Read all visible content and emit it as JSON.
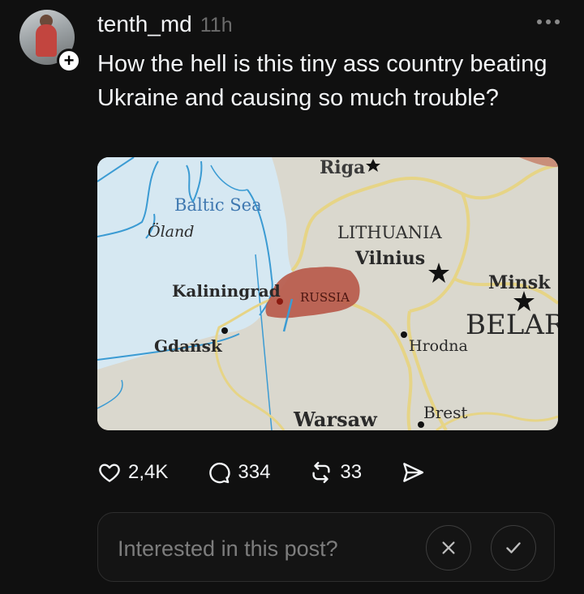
{
  "post": {
    "username": "tenth_md",
    "time": "11h",
    "text": "How the hell is this tiny ass country beating Ukraine and causing so much trouble?",
    "follow_glyph": "+"
  },
  "map": {
    "labels": {
      "riga": "Riga",
      "baltic_sea": "Baltic Sea",
      "oland": "Öland",
      "lithuania": "LITHUANIA",
      "vilnius": "Vilnius",
      "minsk": "Minsk",
      "kaliningrad": "Kaliningrad",
      "russia": "RUSSIA",
      "belarus": "BELAR",
      "gdansk": "Gdańsk",
      "hrodna": "Hrodna",
      "warsaw": "Warsaw",
      "brest": "Brest"
    },
    "colors": {
      "water": "#d6e8f2",
      "land": "#dbd9cf",
      "border": "#e6d486",
      "russia_fill": "#b85a4b",
      "river": "#3b9bd3"
    }
  },
  "actions": {
    "likes": "2,4K",
    "replies": "334",
    "reposts": "33"
  },
  "interest": {
    "question": "Interested in this post?"
  },
  "icons": [
    "heart-icon",
    "comment-icon",
    "repost-icon",
    "share-icon",
    "close-icon",
    "check-icon",
    "more-icon",
    "plus-icon"
  ]
}
